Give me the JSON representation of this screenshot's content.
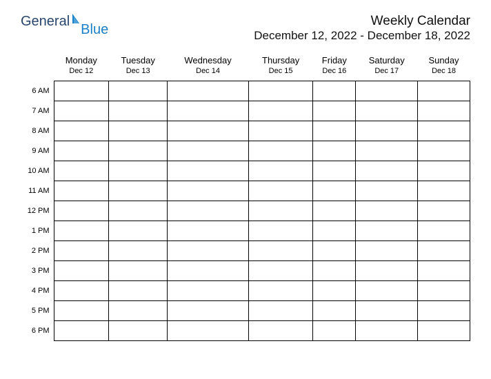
{
  "logo": {
    "text1": "General",
    "text2": "Blue"
  },
  "header": {
    "title": "Weekly Calendar",
    "date_range": "December 12, 2022 - December 18, 2022"
  },
  "days": [
    {
      "name": "Monday",
      "date": "Dec 12"
    },
    {
      "name": "Tuesday",
      "date": "Dec 13"
    },
    {
      "name": "Wednesday",
      "date": "Dec 14"
    },
    {
      "name": "Thursday",
      "date": "Dec 15"
    },
    {
      "name": "Friday",
      "date": "Dec 16"
    },
    {
      "name": "Saturday",
      "date": "Dec 17"
    },
    {
      "name": "Sunday",
      "date": "Dec 18"
    }
  ],
  "hours": [
    "6 AM",
    "7 AM",
    "8 AM",
    "9 AM",
    "10 AM",
    "11 AM",
    "12 PM",
    "1 PM",
    "2 PM",
    "3 PM",
    "4 PM",
    "5 PM",
    "6 PM"
  ]
}
